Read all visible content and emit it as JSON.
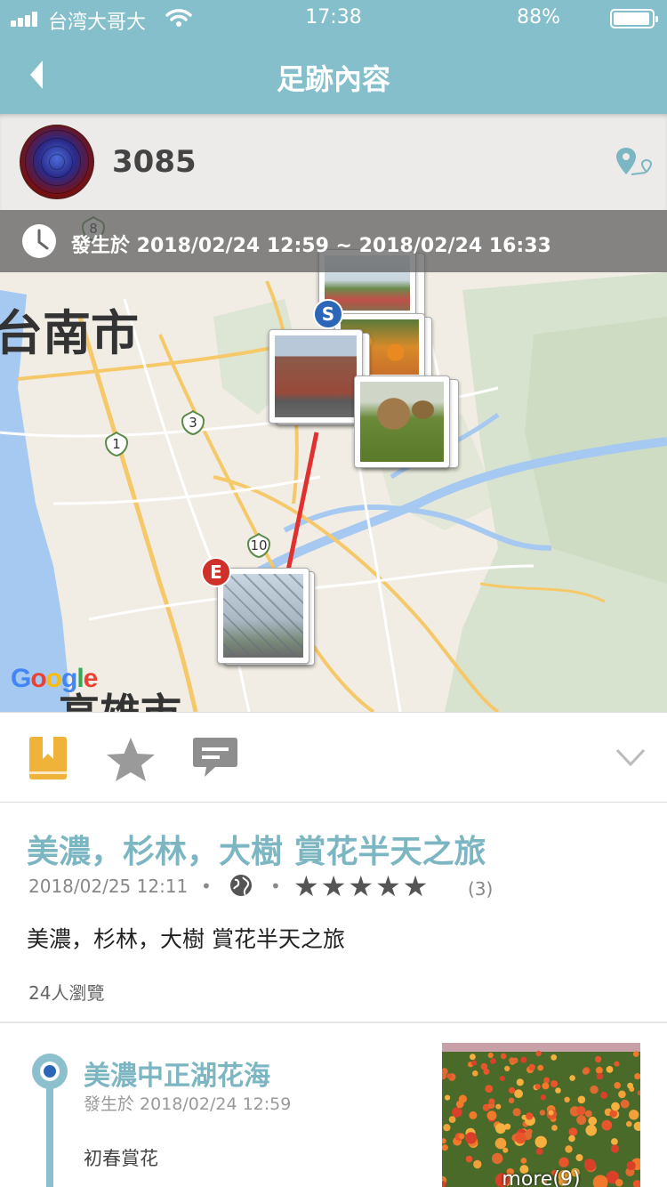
{
  "status_bar": {
    "carrier": "台湾大哥大",
    "time": "17:38",
    "battery": "88%",
    "battery_level": 0.88
  },
  "nav": {
    "title": "足跡內容",
    "back_icon": "chevron-left-icon"
  },
  "user": {
    "name": "3085",
    "location_icon": "map-pin-icon"
  },
  "map": {
    "time_banner": "發生於 2018/02/24 12:59 ~ 2018/02/24 16:33",
    "city_north": "台南市",
    "city_south": "高雄市",
    "start_marker": "S",
    "end_marker": "E",
    "route_shields": [
      "8",
      "3",
      "1",
      "10"
    ],
    "attribution": "Google",
    "route_color": "#e03030"
  },
  "toolbar": {
    "icons": [
      "bookmark-icon",
      "star-icon",
      "comment-icon",
      "chevron-down-icon"
    ],
    "bookmark_color": "#f0b33a"
  },
  "trip": {
    "title": "美濃，杉林，大樹 賞花半天之旅",
    "date": "2018/02/25 12:11",
    "privacy_icon": "globe-icon",
    "rating": 5,
    "rating_stars": "★★★★★",
    "rating_count": "(3)",
    "description": "美濃，杉林，大樹 賞花半天之旅",
    "views": "24人瀏覽"
  },
  "timeline": [
    {
      "title": "美濃中正湖花海",
      "time": "發生於 2018/02/24 12:59",
      "note": "初春賞花",
      "more": "more(9)"
    }
  ],
  "colors": {
    "header": "#84bfcb",
    "accent_text": "#7cb6c2"
  }
}
